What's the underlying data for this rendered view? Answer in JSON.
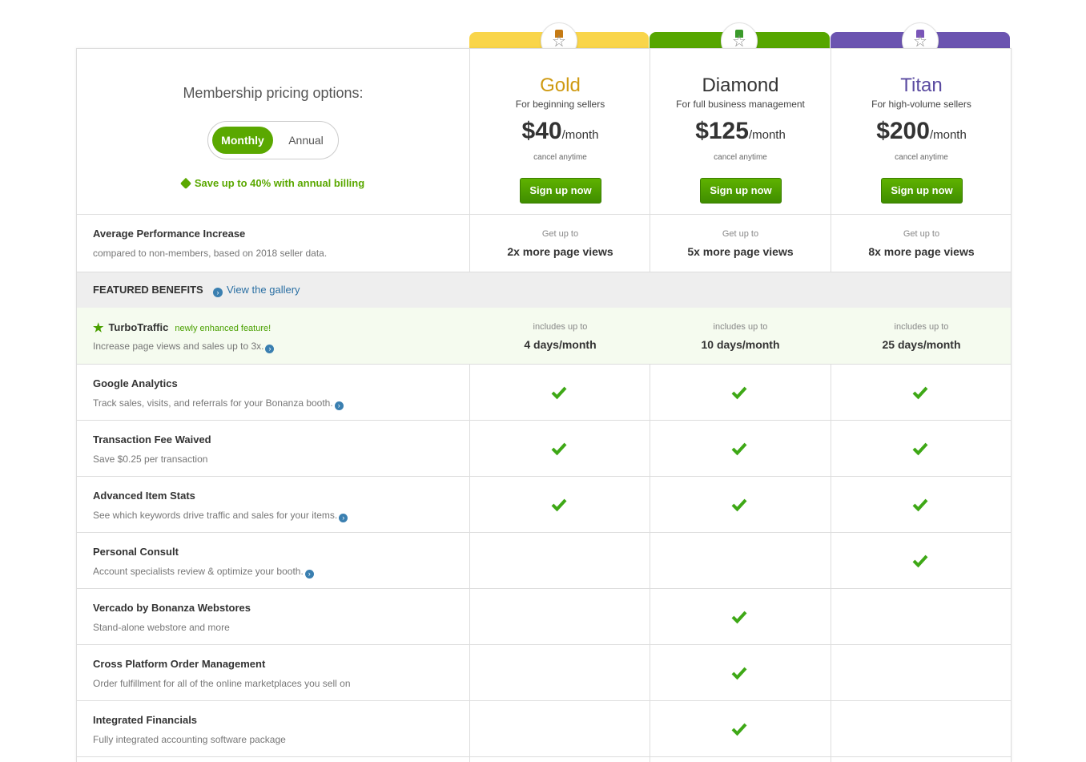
{
  "header": {
    "title": "Membership pricing options:",
    "toggle": {
      "monthly_label": "Monthly",
      "annual_label": "Annual"
    },
    "save_text": "Save up to 40% with annual billing"
  },
  "plans": [
    {
      "name": "Gold",
      "tagline": "For beginning sellers",
      "price": "$40",
      "period": "/month",
      "cancel": "cancel anytime",
      "button": "Sign up now",
      "color": "#cf9a12",
      "cap_color": "#f9d54a",
      "ribbon_color": "#c57a14"
    },
    {
      "name": "Diamond",
      "tagline": "For full business management",
      "price": "$125",
      "period": "/month",
      "cancel": "cancel anytime",
      "button": "Sign up now",
      "color": "#333333",
      "cap_color": "#56a600",
      "ribbon_color": "#3a9a2a"
    },
    {
      "name": "Titan",
      "tagline": "For high-volume sellers",
      "price": "$200",
      "period": "/month",
      "cancel": "cancel anytime",
      "button": "Sign up now",
      "color": "#5a4aa0",
      "cap_color": "#6b54b0",
      "ribbon_color": "#7a55b8"
    }
  ],
  "performance": {
    "label": "Average Performance Increase",
    "desc": "compared to non-members, based on 2018 seller data.",
    "prefix": "Get up to",
    "values": [
      "2x more page views",
      "5x more page views",
      "8x more page views"
    ]
  },
  "featured": {
    "title": "FEATURED BENEFITS",
    "link": "View the gallery"
  },
  "turbo": {
    "label": "TurboTraffic",
    "badge": "newly enhanced feature!",
    "desc": "Increase page views and sales up to 3x.",
    "prefix": "includes up to",
    "values": [
      "4 days/month",
      "10 days/month",
      "25 days/month"
    ]
  },
  "benefits": [
    {
      "label": "Google Analytics",
      "desc": "Track sales, visits, and referrals for your Bonanza booth.",
      "info": true,
      "included": [
        true,
        true,
        true
      ]
    },
    {
      "label": "Transaction Fee Waived",
      "desc": "Save $0.25 per transaction",
      "info": false,
      "included": [
        true,
        true,
        true
      ]
    },
    {
      "label": "Advanced Item Stats",
      "desc": "See which keywords drive traffic and sales for your items.",
      "info": true,
      "included": [
        true,
        true,
        true
      ]
    },
    {
      "label": "Personal Consult",
      "desc": "Account specialists review & optimize your booth.",
      "info": true,
      "included": [
        false,
        false,
        true
      ]
    },
    {
      "label": "Vercado by Bonanza Webstores",
      "desc": "Stand-alone webstore and more",
      "info": false,
      "included": [
        false,
        true,
        false
      ]
    },
    {
      "label": "Cross Platform Order Management",
      "desc": "Order fulfillment for all of the online marketplaces you sell on",
      "info": false,
      "included": [
        false,
        true,
        false
      ]
    },
    {
      "label": "Integrated Financials",
      "desc": "Fully integrated accounting software package",
      "info": false,
      "included": [
        false,
        true,
        false
      ]
    }
  ],
  "icons": {
    "check": "check-icon",
    "info": "chevron-right-circle-icon",
    "tag": "tag-icon",
    "star": "star-icon",
    "medal": "medal-icon"
  }
}
